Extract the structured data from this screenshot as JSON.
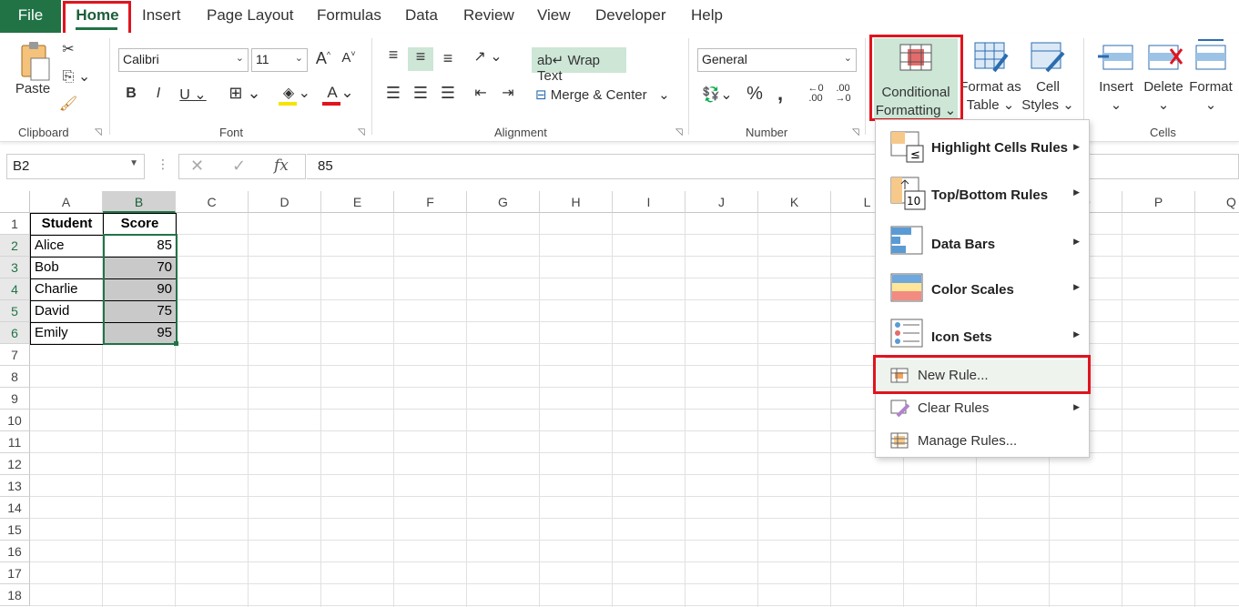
{
  "tabs": [
    "File",
    "Home",
    "Insert",
    "Page Layout",
    "Formulas",
    "Data",
    "Review",
    "View",
    "Developer",
    "Help"
  ],
  "clipboard": {
    "paste": "Paste",
    "group": "Clipboard"
  },
  "font": {
    "name": "Calibri",
    "size": "11",
    "group": "Font"
  },
  "alignment": {
    "wrap": "Wrap Text",
    "merge": "Merge & Center",
    "group": "Alignment"
  },
  "number": {
    "format": "General",
    "group": "Number"
  },
  "styles": {
    "cf1": "Conditional",
    "cf2": "Formatting",
    "fat1": "Format as",
    "fat2": "Table",
    "cs1": "Cell",
    "cs2": "Styles"
  },
  "cells_group": {
    "insert": "Insert",
    "delete": "Delete",
    "format": "Format",
    "group": "Cells"
  },
  "formula_bar": {
    "name_box": "B2",
    "value": "85"
  },
  "columns": [
    "A",
    "B",
    "C",
    "D",
    "E",
    "F",
    "G",
    "H",
    "I",
    "J",
    "K",
    "L",
    "M",
    "N",
    "O",
    "P",
    "Q"
  ],
  "rows": [
    "1",
    "2",
    "3",
    "4",
    "5",
    "6",
    "7",
    "8",
    "9",
    "10",
    "11",
    "12",
    "13",
    "14",
    "15",
    "16",
    "17",
    "18"
  ],
  "table": {
    "headers": [
      "Student",
      "Score"
    ],
    "data": [
      [
        "Alice",
        "85"
      ],
      [
        "Bob",
        "70"
      ],
      [
        "Charlie",
        "90"
      ],
      [
        "David",
        "75"
      ],
      [
        "Emily",
        "95"
      ]
    ]
  },
  "menu": {
    "highlight": "Highlight Cells Rules",
    "topbottom": "Top/Bottom Rules",
    "databars": "Data Bars",
    "colorscales": "Color Scales",
    "iconsets": "Icon Sets",
    "newrule": "New Rule...",
    "clearrules": "Clear Rules",
    "managerules": "Manage Rules..."
  },
  "colors": {
    "accent": "#217346",
    "highlight_box": "#e0141e",
    "selected_fill": "#cde6d6"
  }
}
